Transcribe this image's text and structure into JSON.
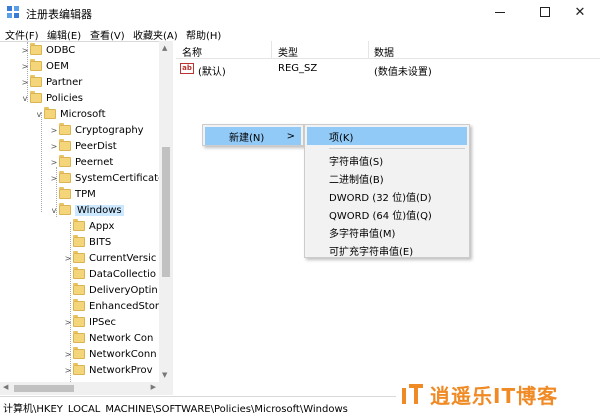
{
  "window": {
    "title": "注册表编辑器",
    "close_glyph": "✕"
  },
  "menu": [
    "文件(F)",
    "编辑(E)",
    "查看(V)",
    "收藏夹(A)",
    "帮助(H)"
  ],
  "tree": [
    {
      "label": "ODBC",
      "expander": ">"
    },
    {
      "label": "OEM",
      "expander": ">"
    },
    {
      "label": "Partner",
      "expander": ">"
    },
    {
      "label": "Policies",
      "expander": "v"
    },
    {
      "label": "Microsoft",
      "expander": "v"
    },
    {
      "label": "Cryptography",
      "expander": ">"
    },
    {
      "label": "PeerDist",
      "expander": ">"
    },
    {
      "label": "Peernet",
      "expander": ">"
    },
    {
      "label": "SystemCertificate",
      "expander": ">"
    },
    {
      "label": "TPM",
      "expander": ""
    },
    {
      "label": "Windows",
      "expander": "v"
    },
    {
      "label": "Appx",
      "expander": ""
    },
    {
      "label": "BITS",
      "expander": ""
    },
    {
      "label": "CurrentVersic",
      "expander": ">"
    },
    {
      "label": "DataCollectio",
      "expander": ""
    },
    {
      "label": "DeliveryOptin",
      "expander": ""
    },
    {
      "label": "EnhancedStor",
      "expander": ""
    },
    {
      "label": "IPSec",
      "expander": ">"
    },
    {
      "label": "Network Con",
      "expander": ""
    },
    {
      "label": "NetworkConn",
      "expander": ">"
    },
    {
      "label": "NetworkProv",
      "expander": ">"
    }
  ],
  "list": {
    "headers": {
      "name": "名称",
      "type": "类型",
      "data": "数据"
    },
    "rows": [
      {
        "icon": "ab",
        "name": "(默认)",
        "type": "REG_SZ",
        "data": "(数值未设置)"
      }
    ]
  },
  "context_menu": {
    "new_label": "新建(N)",
    "arrow": ">"
  },
  "submenu": {
    "key": "项(K)",
    "items": [
      "字符串值(S)",
      "二进制值(B)",
      "DWORD (32 位)值(D)",
      "QWORD (64 位)值(Q)",
      "多字符串值(M)",
      "可扩充字符串值(E)"
    ]
  },
  "status": "计算机\\HKEY_LOCAL_MACHINE\\SOFTWARE\\Policies\\Microsoft\\Windows",
  "watermark": {
    "text": "逍遥乐IT博客"
  },
  "colors": {
    "highlight": "#91c9f7",
    "selection": "#cce8ff",
    "folder": "#f4d57a",
    "watermark": "#f08a24"
  }
}
